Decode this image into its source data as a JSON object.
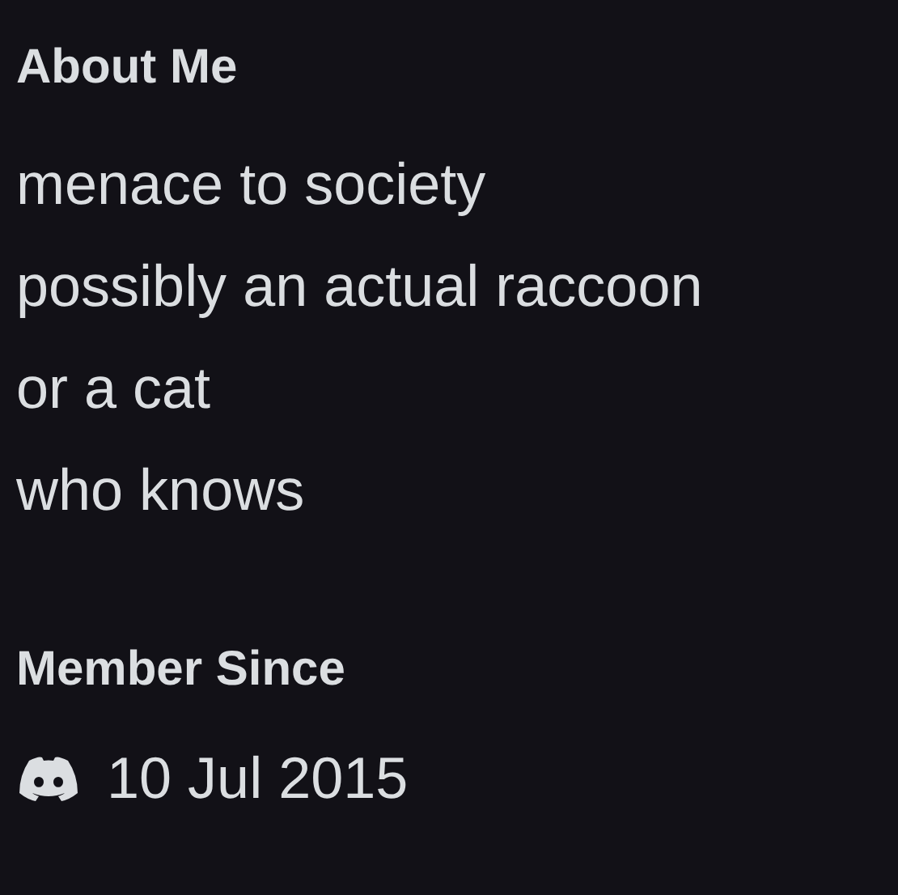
{
  "about_me": {
    "heading": "About Me",
    "text": "menace to society\npossibly an actual raccoon\nor a cat\nwho knows"
  },
  "member_since": {
    "heading": "Member Since",
    "date": "10 Jul 2015"
  }
}
